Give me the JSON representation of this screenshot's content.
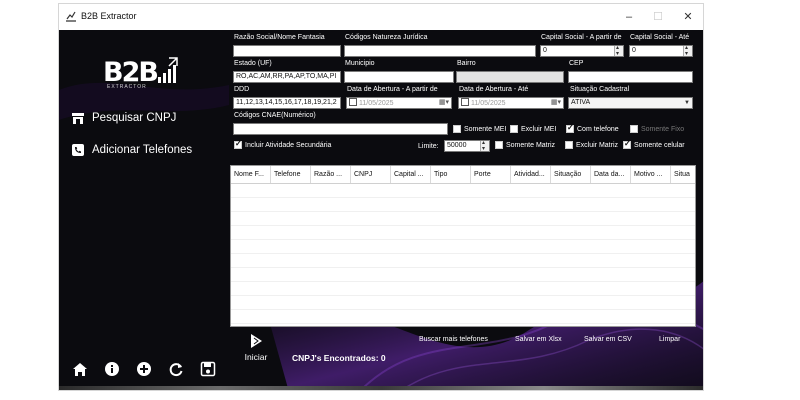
{
  "window": {
    "title": "B2B Extractor",
    "minimize": "–",
    "maximize": "☐",
    "close": "✕"
  },
  "logo": {
    "text": "B2B",
    "sub": "EXTRACTOR"
  },
  "sidebar": {
    "items": [
      {
        "label": "Pesquisar CNPJ",
        "icon": "store-icon"
      },
      {
        "label": "Adicionar Telefones",
        "icon": "phone-icon"
      }
    ],
    "bottom_icons": [
      "home-icon",
      "info-icon",
      "add-icon",
      "refresh-icon",
      "save-icon"
    ]
  },
  "form": {
    "razao_label": "Razão Social/Nome Fantasia",
    "razao_value": "",
    "natureza_label": "Códigos Natureza Jurídica",
    "natureza_value": "",
    "capital_de_label": "Capital Social - A partir de",
    "capital_de_value": "0",
    "capital_ate_label": "Capital Social - Até",
    "capital_ate_value": "0",
    "uf_label": "Estado (UF)",
    "uf_value": "RO,AC,AM,RR,PA,AP,TO,MA,PI",
    "municipio_label": "Municipio",
    "municipio_value": "",
    "bairro_label": "Bairro",
    "bairro_value": "",
    "cep_label": "CEP",
    "cep_value": "",
    "ddd_label": "DDD",
    "ddd_value": "11,12,13,14,15,16,17,18,19,21,2",
    "abertura_de_label": "Data de Abertura - A partir de",
    "abertura_de_value": "11/05/2025",
    "abertura_ate_label": "Data de Abertura - Até",
    "abertura_ate_value": "11/05/2025",
    "situacao_label": "Situação Cadastral",
    "situacao_value": "ATIVA",
    "cnae_label": "Códigos CNAE(Numérico)",
    "cnae_value": "",
    "somente_mei": "Somente MEI",
    "excluir_mei": "Excluir MEI",
    "com_telefone": "Com telefone",
    "somente_fixo": "Somente Fixo",
    "incluir_secundaria": "Incluir Atividade Secundária",
    "limite_label": "Limite:",
    "limite_value": "50000",
    "somente_matriz": "Somente Matriz",
    "excluir_matriz": "Excluir Matriz",
    "somente_celular": "Somente celular"
  },
  "table": {
    "columns": [
      "Nome F...",
      "Telefone",
      "Razão ...",
      "CNPJ",
      "Capital ...",
      "Tipo",
      "Porte",
      "Atividad...",
      "Situação",
      "Data da...",
      "Motivo ...",
      "Situa"
    ]
  },
  "actions": {
    "buscar": "Buscar mais telefones",
    "salvar_xlsx": "Salvar em Xlsx",
    "salvar_csv": "Salvar em CSV",
    "limpar": "Limpar",
    "iniciar": "Iniciar"
  },
  "status": {
    "found": "CNPJ's Encontrados: 0"
  }
}
